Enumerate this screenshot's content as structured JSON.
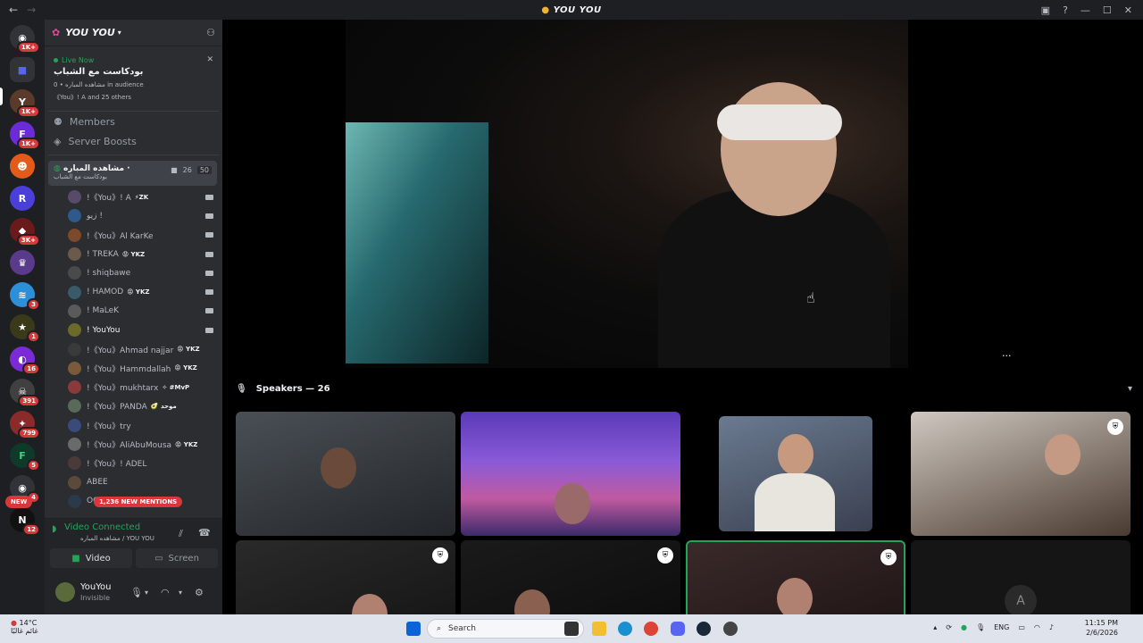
{
  "window": {
    "title": "YOU YOU"
  },
  "server": {
    "name": "YOU YOU"
  },
  "live": {
    "tag": "Live Now",
    "title": "بودكاست مع الشباب",
    "meta1": "مشاهده المباره • 0 in audience",
    "meta2": "《You》! A and 25 others"
  },
  "sidebar_links": {
    "members": "Members",
    "boosts": "Server Boosts"
  },
  "voice_channel": {
    "name": "مشاهده المباره ·",
    "topic": "بودكاست مع الشباب",
    "video_count": "26",
    "limit": "50"
  },
  "users": [
    {
      "name": "!《You》! A",
      "tag": "⚡ZK"
    },
    {
      "name": "زيو !",
      "tag": ""
    },
    {
      "name": "!《You》Al KarKe",
      "tag": ""
    },
    {
      "name": "! TREKA",
      "tag": "😡 YKZ"
    },
    {
      "name": "! shiqbawe",
      "tag": ""
    },
    {
      "name": "! HAMOD",
      "tag": "😡 YKZ"
    },
    {
      "name": "! MaLeK",
      "tag": ""
    },
    {
      "name": "! YouYou",
      "tag": ""
    },
    {
      "name": "!《You》Ahmad najjar",
      "tag": "😡 YKZ"
    },
    {
      "name": "!《You》Hammdallah",
      "tag": "😡 YKZ"
    },
    {
      "name": "!《You》mukhtarx",
      "tag": "✧ #MvP"
    },
    {
      "name": "!《You》PANDA",
      "tag": "🥑 موحد"
    },
    {
      "name": "!《You》try",
      "tag": ""
    },
    {
      "name": "!《You》AliAbuMousa",
      "tag": "😡 YKZ"
    },
    {
      "name": "!《You》! ADEL",
      "tag": ""
    },
    {
      "name": "ABEE",
      "tag": ""
    },
    {
      "name": "OGHUSNI",
      "tag": "BT"
    }
  ],
  "mentions": "1,236 NEW MENTIONS",
  "new_pill": "NEW",
  "voice_panel": {
    "status": "Video Connected",
    "sub": "مشاهده المباره / YOU YOU",
    "video_btn": "Video",
    "screen_btn": "Screen"
  },
  "user_panel": {
    "name": "YouYou",
    "status": "Invisible"
  },
  "rail_badges": [
    "1K+",
    "1K+",
    "1K+",
    "3K+",
    "3",
    "1",
    "16",
    "391",
    "799",
    "5",
    "4",
    "12"
  ],
  "speakers_label": "Speakers — 26",
  "taskbar": {
    "temp": "14°C",
    "weather": "غائم غالبًا",
    "search": "Search",
    "lang": "ENG",
    "time": "11:15 PM",
    "date": "2/6/2026"
  },
  "colors": {
    "accent_green": "#23a559",
    "badge_red": "#da373c",
    "sidebar": "#2b2d31"
  }
}
